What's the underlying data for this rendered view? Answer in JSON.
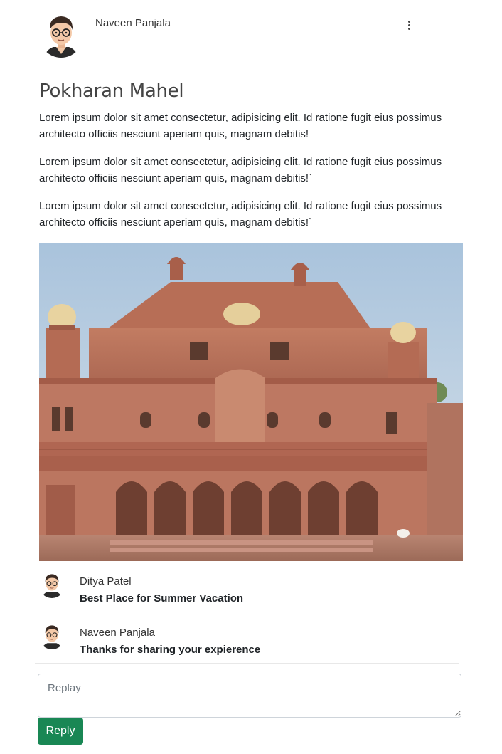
{
  "post": {
    "author": "Naveen Panjala",
    "menu_icon": "kebab-menu-icon",
    "title": "Pokharan Mahel",
    "paragraphs": [
      "Lorem ipsum dolor sit amet consectetur, adipisicing elit. Id ratione fugit eius possimus architecto officiis nesciunt aperiam quis, magnam debitis!",
      "Lorem ipsum dolor sit amet consectetur, adipisicing elit. Id ratione fugit eius possimus architecto officiis nesciunt aperiam quis, magnam debitis!`",
      "Lorem ipsum dolor sit amet consectetur, adipisicing elit. Id ratione fugit eius possimus architecto officiis nesciunt aperiam quis, magnam debitis!`"
    ]
  },
  "comments": [
    {
      "name": "Ditya Patel",
      "text": "Best Place for Summer Vacation"
    },
    {
      "name": "Naveen Panjala",
      "text": "Thanks for sharing your expierence"
    }
  ],
  "reply": {
    "placeholder": "Replay",
    "button_label": "Reply"
  },
  "colors": {
    "button_bg": "#198754",
    "sandstone": "#b7705a",
    "sky": "#b9cfe0"
  }
}
